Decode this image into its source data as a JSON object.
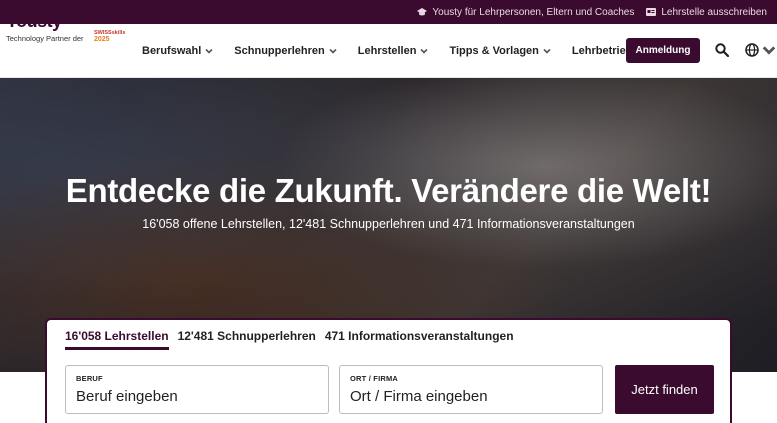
{
  "topbar": {
    "links": [
      {
        "label": "Yousty für Lehrpersonen, Eltern und Coaches",
        "icon": "graduation-cap-icon"
      },
      {
        "label": "Lehrstelle ausschreiben",
        "icon": "id-card-icon"
      }
    ]
  },
  "brand": {
    "logo": "Yousty",
    "tagline": "Technology Partner der",
    "partner_line1": "SWISSskills",
    "partner_line2": "2025"
  },
  "nav": {
    "items": [
      {
        "label": "Berufswahl"
      },
      {
        "label": "Schnupperlehren"
      },
      {
        "label": "Lehrstellen"
      },
      {
        "label": "Tipps & Vorlagen"
      },
      {
        "label": "Lehrbetriebe"
      }
    ],
    "login_label": "Anmeldung"
  },
  "hero": {
    "title": "Entdecke die Zukunft. Verändere die Welt!",
    "subtitle": "16'058 offene Lehrstellen, 12'481 Schnupperlehren und 471 Informationsveranstaltungen"
  },
  "search": {
    "tabs": [
      {
        "label": "16'058 Lehrstellen",
        "active": true
      },
      {
        "label": "12'481 Schnupperlehren",
        "active": false
      },
      {
        "label": "471 Informationsveranstaltungen",
        "active": false
      }
    ],
    "field1": {
      "label": "BERUF",
      "placeholder": "Beruf eingeben"
    },
    "field2": {
      "label": "ORT / FIRMA",
      "placeholder": "Ort / Firma eingeben"
    },
    "button_label": "Jetzt finden"
  },
  "colors": {
    "brand": "#3a0b2e"
  }
}
